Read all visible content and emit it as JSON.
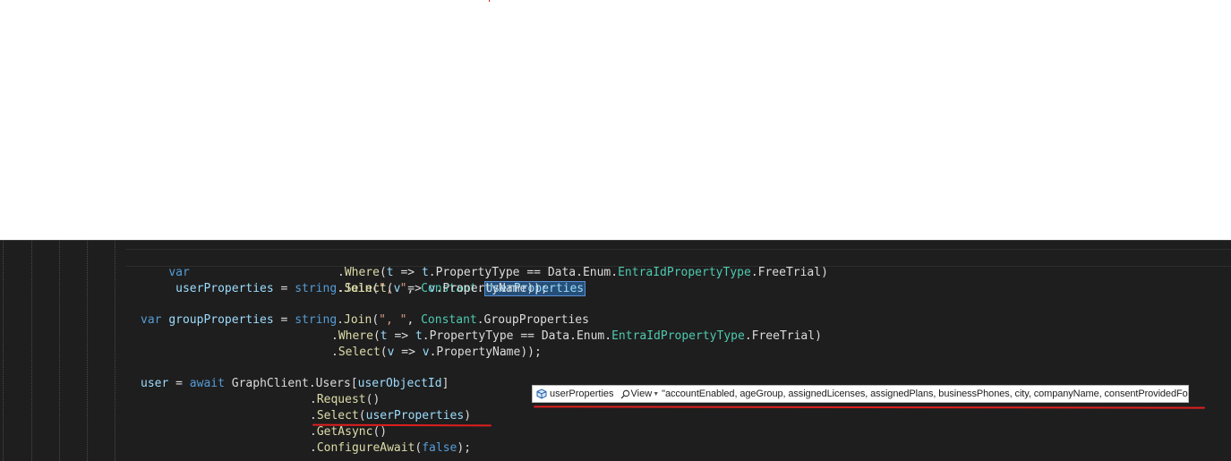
{
  "code": {
    "line1": {
      "kw_var": "var",
      "var_name": "userProperties",
      "op_eq": " = ",
      "type_string": "string",
      "dot1": ".",
      "meth_join": "Join",
      "open": "(",
      "str_sep": "\", \"",
      "comma": ", ",
      "type_constant": "Constant",
      "dot2": ".",
      "selected_member": "UserProperties"
    },
    "line2": {
      "dot_where": ".",
      "meth_where": "Where",
      "open": "(",
      "lambda_var": "t",
      "arrow": " => ",
      "lambda_ref": "t",
      "member_path": ".PropertyType == Data.Enum.",
      "type_enum": "EntraIdPropertyType",
      "tail": ".FreeTrial)"
    },
    "line3": {
      "dot_select": ".",
      "meth_select": "Select",
      "open": "(",
      "lambda_var": "v",
      "arrow": " => ",
      "lambda_ref": "v",
      "tail": ".PropertyName));"
    },
    "line4": {
      "kw_var": "var",
      "var_name": "groupProperties",
      "op_eq": " = ",
      "type_string": "string",
      "dot1": ".",
      "meth_join": "Join",
      "open": "(",
      "str_sep": "\", \"",
      "comma": ", ",
      "type_constant": "Constant",
      "tail": ".GroupProperties"
    },
    "line5": {
      "dot_where": ".",
      "meth_where": "Where",
      "open": "(",
      "lambda_var": "t",
      "arrow": " => ",
      "lambda_ref": "t",
      "member_path": ".PropertyType == Data.Enum.",
      "type_enum": "EntraIdPropertyType",
      "tail": ".FreeTrial)"
    },
    "line6": {
      "dot_select": ".",
      "meth_select": "Select",
      "open": "(",
      "lambda_var": "v",
      "arrow": " => ",
      "lambda_ref": "v",
      "tail": ".PropertyName));"
    },
    "line7": {
      "var_user": "user",
      "op_eq": " = ",
      "kw_await": "await",
      "target": " GraphClient.Users[",
      "arg": "userObjectId",
      "close": "]"
    },
    "line8": {
      "dot": ".",
      "meth": "Request",
      "tail": "()"
    },
    "line9": {
      "dot": ".",
      "meth": "Select",
      "open": "(",
      "arg": "userProperties",
      "close": ")"
    },
    "line10": {
      "dot": ".",
      "meth": "GetAsync",
      "tail": "()"
    },
    "line11": {
      "dot": ".",
      "meth": "ConfigureAwait",
      "open": "(",
      "kw_false": "false",
      "tail": ");"
    }
  },
  "datatip": {
    "variable_name": "userProperties",
    "icon": "local-variable-icon",
    "view_icon": "magnifier-icon",
    "view_label": "View",
    "value": "\"accountEnabled, ageGroup, assignedLicenses, assignedPlans, businessPhones, city, companyName, consentProvidedForMinor,"
  },
  "colors": {
    "editor_background": "#1e1e1e",
    "keyword": "#569cd6",
    "variable": "#9cdcfe",
    "method": "#dcdcaa",
    "type": "#4ec9b0",
    "string": "#d69d85",
    "annotation_red": "#e01e1e"
  }
}
